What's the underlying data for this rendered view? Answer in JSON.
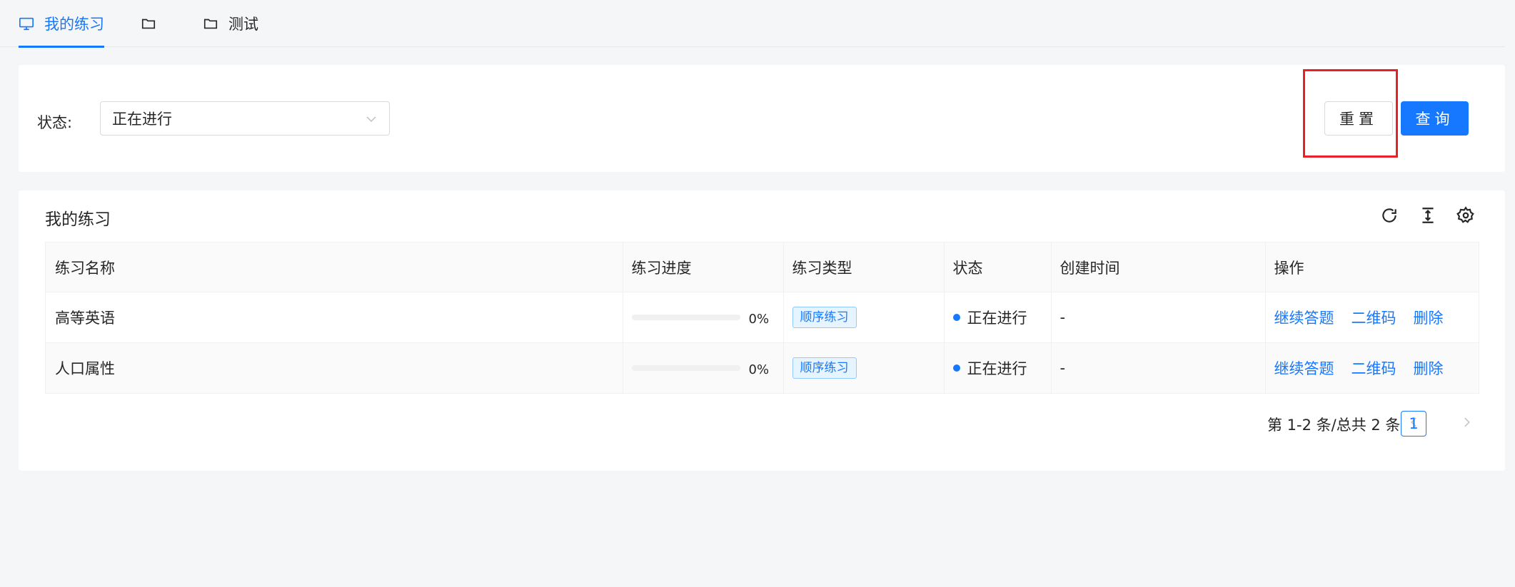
{
  "tabs": [
    {
      "label": "我的练习",
      "icon": "monitor-icon",
      "active": true
    },
    {
      "label": "",
      "icon": "folder-icon",
      "active": false
    },
    {
      "label": "测试",
      "icon": "folder-icon",
      "active": false
    }
  ],
  "filter": {
    "status_label": "状态:",
    "status_value": "正在进行",
    "reset_label": "重置",
    "query_label": "查询"
  },
  "table_card": {
    "title": "我的练习",
    "toolbar_icons": [
      "refresh-icon",
      "column-height-icon",
      "settings-icon"
    ],
    "columns": [
      "练习名称",
      "练习进度",
      "练习类型",
      "状态",
      "创建时间",
      "操作"
    ],
    "rows": [
      {
        "name": "高等英语",
        "progress": 0,
        "progress_text": "0%",
        "type": "顺序练习",
        "status": "正在进行",
        "created": "-",
        "actions": [
          "继续答题",
          "二维码",
          "删除"
        ]
      },
      {
        "name": "人口属性",
        "progress": 0,
        "progress_text": "0%",
        "type": "顺序练习",
        "status": "正在进行",
        "created": "-",
        "actions": [
          "继续答题",
          "二维码",
          "删除"
        ]
      }
    ]
  },
  "pagination": {
    "total_text": "第 1-2 条/总共 2 条",
    "current_page": "1"
  },
  "colors": {
    "primary": "#1677ff",
    "highlight": "#e8202a"
  }
}
